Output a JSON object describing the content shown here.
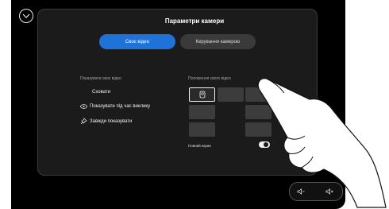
{
  "panel": {
    "title": "Параметри камери"
  },
  "tabs": [
    {
      "label": "Своє відео"
    },
    {
      "label": "Керування камерою"
    }
  ],
  "show_video": {
    "section_label": "Показувати своє відео",
    "options": [
      {
        "label": "Сховати"
      },
      {
        "label": "Показувати під час виклику"
      },
      {
        "label": "Завжди показувати"
      }
    ]
  },
  "position": {
    "section_label": "Положення свого відео",
    "fullscreen_label": "Повний екран",
    "fullscreen_enabled": true
  },
  "icons": {
    "back": "chevron-down-icon",
    "eye": "eye-icon",
    "pin": "pin-icon",
    "self_view": "person-icon",
    "volume_down": "volume-down-icon",
    "volume_up": "volume-up-icon"
  },
  "colors": {
    "accent": "#1f73d8",
    "background": "#000000",
    "panel": "#1b1b1b"
  }
}
